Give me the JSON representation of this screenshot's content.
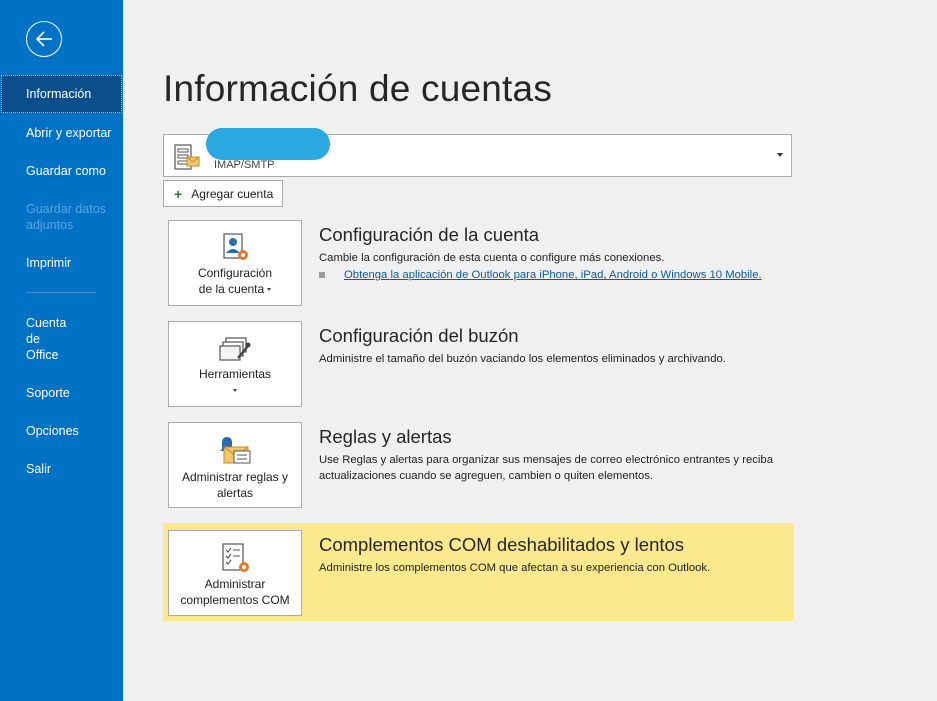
{
  "sidebar": {
    "back_icon": "back-arrow-icon",
    "items": [
      {
        "label": "Información",
        "state": "active"
      },
      {
        "label": "Abrir y exportar",
        "state": "normal"
      },
      {
        "label": "Guardar como",
        "state": "normal"
      },
      {
        "label": "Guardar datos adjuntos",
        "state": "disabled"
      },
      {
        "label": "Imprimir",
        "state": "normal"
      },
      {
        "label": "Cuenta de Office",
        "state": "normal"
      },
      {
        "label": "Soporte",
        "state": "normal"
      },
      {
        "label": "Opciones",
        "state": "normal"
      },
      {
        "label": "Salir",
        "state": "normal"
      }
    ]
  },
  "main": {
    "title": "Información de cuentas",
    "account": {
      "type": "IMAP/SMTP"
    },
    "add_account_label": "Agregar cuenta",
    "sections": [
      {
        "tile_label_1": "Configuración",
        "tile_label_2": "de la cuenta",
        "title": "Configuración de la cuenta",
        "description": "Cambie la configuración de esta cuenta o configure más conexiones.",
        "link": "Obtenga la aplicación de Outlook para iPhone, iPad, Android o Windows 10 Mobile."
      },
      {
        "tile_label_1": "Herramientas",
        "title": "Configuración del buzón",
        "description": "Administre el tamaño del buzón vaciando los elementos eliminados y archivando."
      },
      {
        "tile_label_1": "Administrar reglas y",
        "tile_label_2": "alertas",
        "title": "Reglas y alertas",
        "description": "Use Reglas y alertas para organizar sus mensajes de correo electrónico entrantes y reciba actualizaciones cuando se agreguen, cambien o quiten elementos."
      },
      {
        "tile_label_1": "Administrar",
        "tile_label_2": "complementos COM",
        "title": "Complementos COM deshabilitados y lentos",
        "description": "Administre los complementos COM que afectan a su experiencia con Outlook."
      }
    ]
  },
  "colors": {
    "sidebar_bg": "#0072c6",
    "sidebar_active": "#0a4f8c",
    "highlight": "#fce98d",
    "link": "#0a5ba8"
  }
}
